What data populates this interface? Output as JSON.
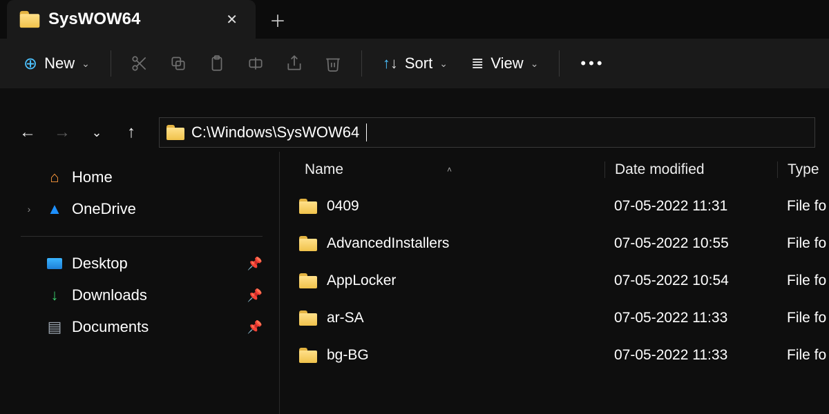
{
  "tab": {
    "title": "SysWOW64"
  },
  "toolbar": {
    "new": "New",
    "sort": "Sort",
    "view": "View"
  },
  "address": "C:\\Windows\\SysWOW64",
  "sidebar": {
    "home": "Home",
    "onedrive": "OneDrive",
    "desktop": "Desktop",
    "downloads": "Downloads",
    "documents": "Documents"
  },
  "columns": {
    "name": "Name",
    "date": "Date modified",
    "type": "Type"
  },
  "rows": [
    {
      "name": "0409",
      "date": "07-05-2022 11:31",
      "type": "File fo"
    },
    {
      "name": "AdvancedInstallers",
      "date": "07-05-2022 10:55",
      "type": "File fo"
    },
    {
      "name": "AppLocker",
      "date": "07-05-2022 10:54",
      "type": "File fo"
    },
    {
      "name": "ar-SA",
      "date": "07-05-2022 11:33",
      "type": "File fo"
    },
    {
      "name": "bg-BG",
      "date": "07-05-2022 11:33",
      "type": "File fo"
    }
  ]
}
